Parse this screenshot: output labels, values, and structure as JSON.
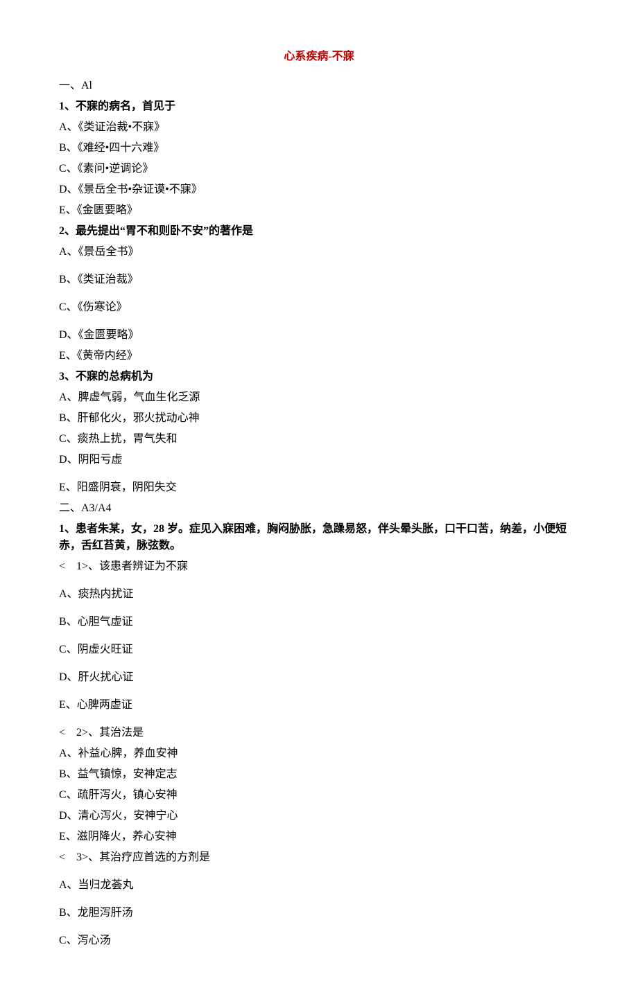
{
  "title": "心系疾病-不寐",
  "section1_label": "一、Al",
  "q1": {
    "stem": "1、不寐的病名，首见于",
    "A": "A、《类证治裁•不寐》",
    "B": "B、《难经•四十六难》",
    "C": "C、《素问•逆调论》",
    "D": "D、《景岳全书•杂证谟•不寐》",
    "E": "E、《金匮要略》"
  },
  "q2": {
    "stem": "2、最先提出“胃不和则卧不安”的著作是",
    "A": "A、《景岳全书》",
    "B": "B、《类证治裁》",
    "C": "C、《伤寒论》",
    "D": "D、《金匮要略》",
    "E": "E、《黄帝内经》"
  },
  "q3": {
    "stem": "3、不寐的总病机为",
    "A": "A、脾虚气弱，气血生化乏源",
    "B": "B、肝郁化火，邪火扰动心神",
    "C": "C、痰热上扰，胃气失和",
    "D": "D、阴阳亏虚",
    "E": "E、阳盛阴衰，阴阳失交"
  },
  "section2_label": "二、A3/A4",
  "case1": {
    "stem": "1、患者朱某，女，28 岁。症见入寐困难，胸闷胁胀，急躁易怒，伴头晕头胀，口干口苦，纳差，小便短赤，舌红苔黄，脉弦数。",
    "sub1": {
      "label": "<　1>、该患者辨证为不寐",
      "A": "A、痰热内扰证",
      "B": "B、心胆气虚证",
      "C": "C、阴虚火旺证",
      "D": "D、肝火扰心证",
      "E": "E、心脾两虚证"
    },
    "sub2": {
      "label": "<　2>、其治法是",
      "A": "A、补益心脾，养血安神",
      "B": "B、益气镇惊，安神定志",
      "C": "C、疏肝泻火，镇心安神",
      "D": "D、清心泻火，安神宁心",
      "E": "E、滋阴降火，养心安神"
    },
    "sub3": {
      "label": "<　3>、其治疗应首选的方剂是",
      "A": "A、当归龙荟丸",
      "B": "B、龙胆泻肝汤",
      "C": "C、泻心汤"
    }
  }
}
